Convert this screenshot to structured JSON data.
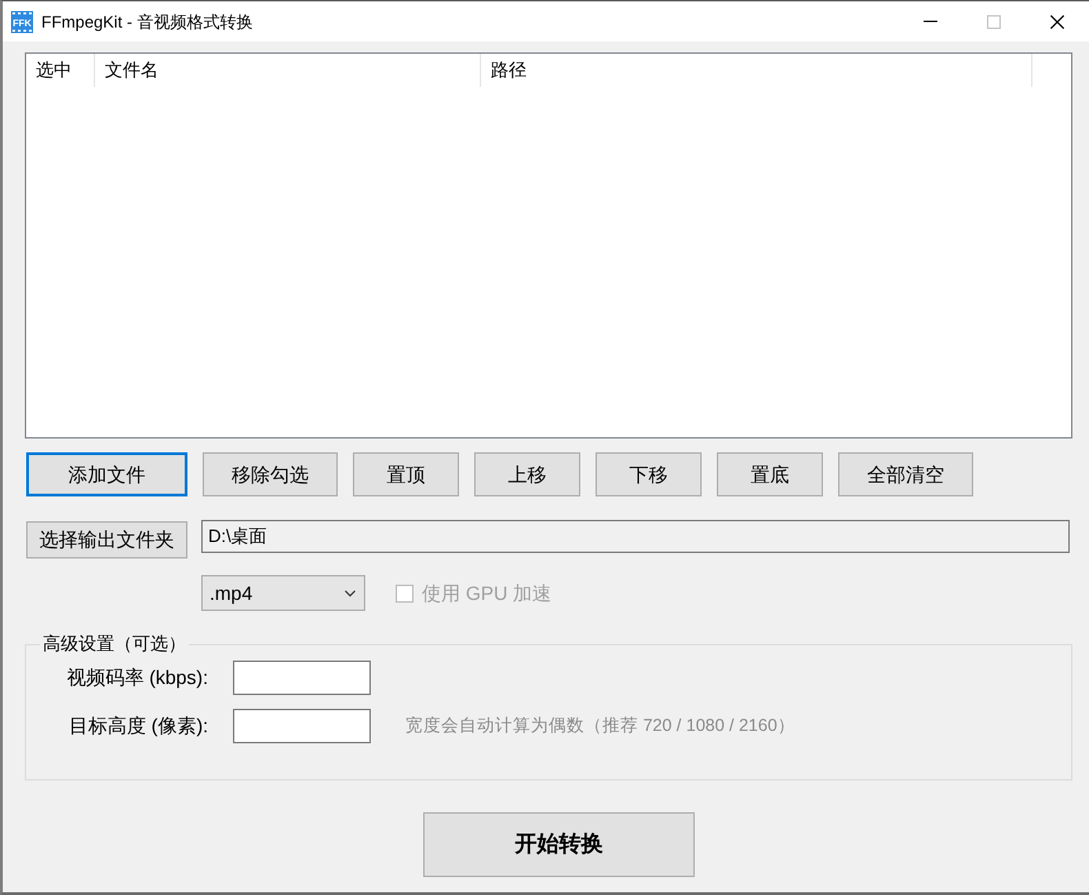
{
  "window": {
    "logo_text": "FFK",
    "title": "FFmpegKit - 音视频格式转换",
    "maximize_disabled": true
  },
  "file_list": {
    "columns": [
      "选中",
      "文件名",
      "路径"
    ]
  },
  "list_buttons": [
    {
      "label": "添加文件",
      "focused": true
    },
    {
      "label": "移除勾选",
      "focused": false
    },
    {
      "label": "置顶",
      "focused": false
    },
    {
      "label": "上移",
      "focused": false
    },
    {
      "label": "下移",
      "focused": false
    },
    {
      "label": "置底",
      "focused": false
    },
    {
      "label": "全部清空",
      "focused": false
    }
  ],
  "output": {
    "button": "选择输出文件夹",
    "path": "D:\\桌面"
  },
  "format": {
    "value": ".mp4"
  },
  "gpu": {
    "label": "使用 GPU 加速",
    "checked": false,
    "disabled": true
  },
  "advanced": {
    "title": "高级设置（可选）",
    "fields": [
      {
        "label": "视频码率 (kbps):"
      },
      {
        "label": "目标高度 (像素):",
        "hint": "宽度会自动计算为偶数（推荐 720 / 1080 / 2160）"
      }
    ]
  },
  "start_button": "开始转换"
}
